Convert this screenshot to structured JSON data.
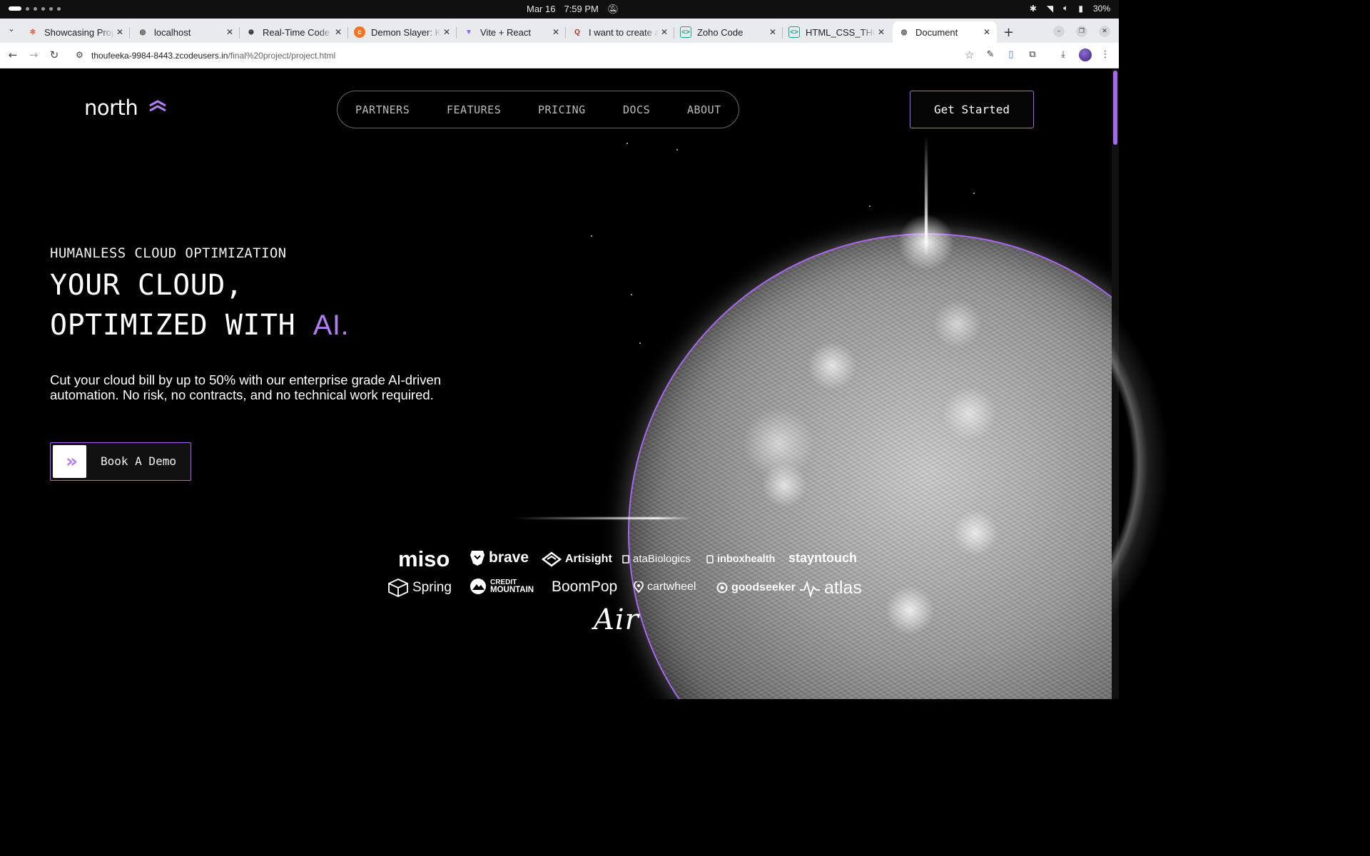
{
  "os": {
    "date": "Mar 16",
    "time": "7:59 PM",
    "battery": "30%"
  },
  "tabs": [
    {
      "label": "Showcasing Proje",
      "icon": "asterisk-icon",
      "active": false
    },
    {
      "label": "localhost",
      "icon": "globe-icon",
      "active": false
    },
    {
      "label": "Real-Time Code E",
      "icon": "openai-icon",
      "active": false
    },
    {
      "label": "Demon Slayer: Ki",
      "icon": "crunchyroll-icon",
      "active": false
    },
    {
      "label": "Vite + React",
      "icon": "vite-icon",
      "active": false
    },
    {
      "label": "I want to create a",
      "icon": "quora-icon",
      "active": false
    },
    {
      "label": "Zoho Code",
      "icon": "zoho-code-icon",
      "active": false
    },
    {
      "label": "HTML_CSS_THOU",
      "icon": "zoho-code-icon",
      "active": false
    },
    {
      "label": "Document",
      "icon": "globe-icon",
      "active": true
    }
  ],
  "address": {
    "host": "thoufeeka-9984-8443.zcodeusers.in",
    "path": "/final%20project/project.html"
  },
  "site": {
    "logo_text": "north",
    "nav": [
      "PARTNERS",
      "FEATURES",
      "PRICING",
      "DOCS",
      "ABOUT"
    ],
    "cta_label": "Get Started",
    "eyebrow": "HUMANLESS CLOUD OPTIMIZATION",
    "headline_line1": "YOUR CLOUD,",
    "headline_line2": "OPTIMIZED WITH ",
    "headline_accent": "AI.",
    "subtext": "Cut your cloud bill by up to 50% with our enterprise grade AI-driven automation. No risk, no contracts, and no technical work required.",
    "demo_label": "Book A Demo",
    "accent_color": "#b27df0",
    "partners_row1": [
      "miso",
      "brave",
      "Artisight",
      "ataBiologics",
      "inboxhealth",
      "stayntouch"
    ],
    "partners_row2": [
      "Spring",
      "CREDIT",
      "MOUNTAIN",
      "BoomPop",
      "cartwheel",
      "goodseeker",
      "atlas"
    ],
    "partners_row3": [
      "Air"
    ]
  }
}
